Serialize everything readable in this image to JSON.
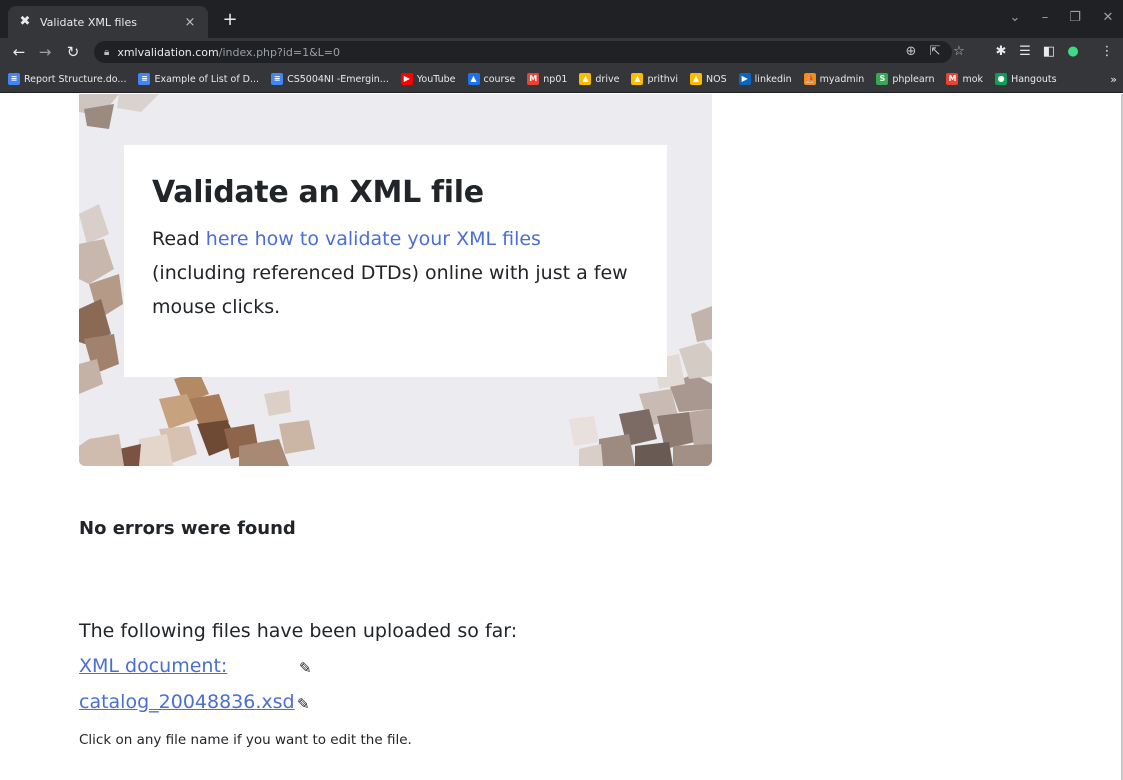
{
  "browser": {
    "tab_title": "Validate XML files",
    "tab_close": "×",
    "new_tab": "+",
    "url_host": "xmlvalidation.com",
    "url_path": "/index.php?id=1&L=0",
    "bookmarks": [
      {
        "label": "Report Structure.do...",
        "icon": "docs-icon",
        "color": "#4285f4",
        "glyph": "≡"
      },
      {
        "label": "Example of List of D...",
        "icon": "docs-icon",
        "color": "#4285f4",
        "glyph": "≡"
      },
      {
        "label": "CS5004NI -Emergin...",
        "icon": "docs-icon",
        "color": "#4285f4",
        "glyph": "≡"
      },
      {
        "label": "YouTube",
        "icon": "youtube-icon",
        "color": "#ff0000",
        "glyph": "▶"
      },
      {
        "label": "course",
        "icon": "classroom-icon",
        "color": "#1e73e8",
        "glyph": "▲"
      },
      {
        "label": "np01",
        "icon": "gmail-icon",
        "color": "#ea4335",
        "glyph": "M"
      },
      {
        "label": "drive",
        "icon": "drive-icon",
        "color": "#fbbc04",
        "glyph": "▲"
      },
      {
        "label": "prithvi",
        "icon": "drive-icon",
        "color": "#fbbc04",
        "glyph": "▲"
      },
      {
        "label": "NOS",
        "icon": "drive-icon",
        "color": "#fbbc04",
        "glyph": "▲"
      },
      {
        "label": "linkedin",
        "icon": "linkedin-icon",
        "color": "#0a66c2",
        "glyph": "▶"
      },
      {
        "label": "myadmin",
        "icon": "phpmyadmin-icon",
        "color": "#f29111",
        "glyph": "⛵"
      },
      {
        "label": "phplearn",
        "icon": "sololearn-icon",
        "color": "#34a853",
        "glyph": "S"
      },
      {
        "label": "mok",
        "icon": "gmail-icon",
        "color": "#ea4335",
        "glyph": "M"
      },
      {
        "label": "Hangouts",
        "icon": "hangouts-icon",
        "color": "#0f9d58",
        "glyph": "●"
      }
    ],
    "bookmarks_more": "»"
  },
  "hero": {
    "heading": "Validate an XML file",
    "intro_prefix": "Read ",
    "intro_link": "here how to validate your XML files",
    "intro_suffix": " (including referenced DTDs) online with just a few mouse clicks."
  },
  "result": {
    "message": "No errors were found"
  },
  "uploads": {
    "heading": "The following files have been uploaded so far:",
    "files": [
      {
        "label": "XML document:",
        "icon": "pencil-icon"
      },
      {
        "label": "catalog_20048836.xsd",
        "icon": "pencil-icon"
      }
    ],
    "hint": "Click on any file name if you want to edit the file."
  },
  "colors": {
    "link": "#4a6ed3",
    "text": "#212529",
    "chrome_dark": "#202124",
    "chrome_toolbar": "#35363a"
  }
}
